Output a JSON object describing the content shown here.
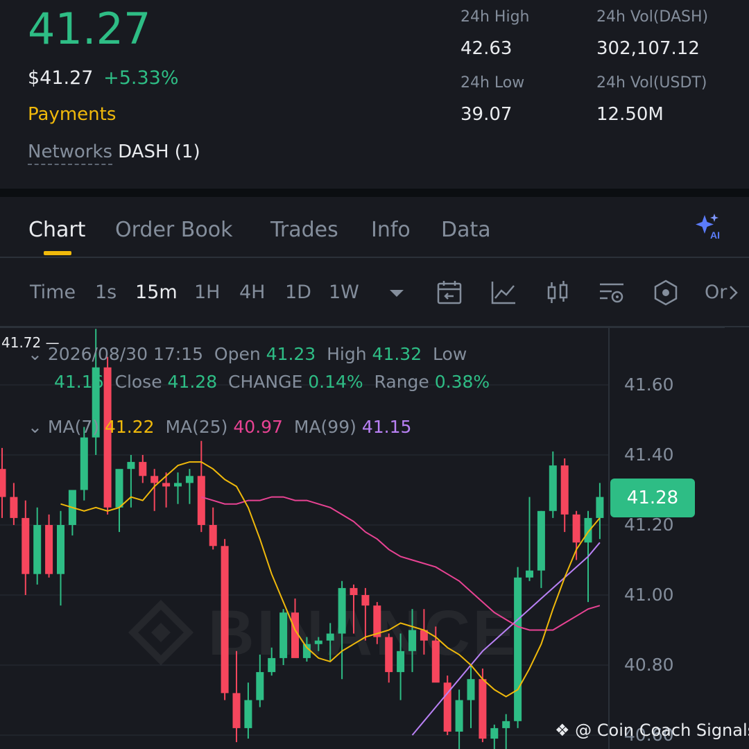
{
  "ticker": {
    "last_price": "41.27",
    "usd_price": "$41.27",
    "change_pct": "+5.33%",
    "category": "Payments",
    "networks_label": "Networks",
    "networks_value": "DASH (1)"
  },
  "stats": {
    "high_label": "24h High",
    "high_value": "42.63",
    "low_label": "24h Low",
    "low_value": "39.07",
    "vol_base_label": "24h Vol(DASH)",
    "vol_base_value": "302,107.12",
    "vol_quote_label": "24h Vol(USDT)",
    "vol_quote_value": "12.50M"
  },
  "tabs": [
    "Chart",
    "Order Book",
    "Trades",
    "Info",
    "Data"
  ],
  "intervals": [
    "Time",
    "1s",
    "15m",
    "1H",
    "4H",
    "1D",
    "1W"
  ],
  "intervals_more": "Or",
  "candle_info": {
    "datetime": "2026/08/30 17:15",
    "open_label": "Open",
    "open": "41.23",
    "high_label": "High",
    "high": "41.32",
    "low_label": "Low",
    "low": "41.16",
    "close_label": "Close",
    "close": "41.28",
    "change_label": "CHANGE",
    "change": "0.14%",
    "range_label": "Range",
    "range": "0.38%"
  },
  "ma_info": {
    "ma7_label": "MA(7)",
    "ma7": "41.22",
    "ma25_label": "MA(25)",
    "ma25": "40.97",
    "ma99_label": "MA(99)",
    "ma99": "41.15"
  },
  "chart": {
    "high_marker": "41.72",
    "last_price_badge": "41.28",
    "y_ticks": [
      "41.60",
      "41.40",
      "41.20",
      "41.00",
      "40.80",
      "40.60"
    ],
    "watermark_text": "BINANCE",
    "credit": "@ Coin Coach Signals"
  },
  "colors": {
    "up": "#2ebd85",
    "down": "#f6465d",
    "accent": "#f0b90b",
    "ma7": "#f0b90b",
    "ma25": "#e84393",
    "ma99": "#b981f5"
  },
  "chart_data": {
    "type": "candlestick",
    "ylim": [
      40.6,
      41.75
    ],
    "candles": [
      {
        "o": 41.36,
        "h": 41.42,
        "l": 41.22,
        "c": 41.28
      },
      {
        "o": 41.28,
        "h": 41.32,
        "l": 41.2,
        "c": 41.22
      },
      {
        "o": 41.22,
        "h": 41.27,
        "l": 41.0,
        "c": 41.06
      },
      {
        "o": 41.06,
        "h": 41.25,
        "l": 41.03,
        "c": 41.2
      },
      {
        "o": 41.2,
        "h": 41.23,
        "l": 41.05,
        "c": 41.06
      },
      {
        "o": 41.06,
        "h": 41.24,
        "l": 40.97,
        "c": 41.2
      },
      {
        "o": 41.2,
        "h": 41.3,
        "l": 41.17,
        "c": 41.3
      },
      {
        "o": 41.3,
        "h": 41.48,
        "l": 41.27,
        "c": 41.45
      },
      {
        "o": 41.45,
        "h": 41.76,
        "l": 41.4,
        "c": 41.65
      },
      {
        "o": 41.65,
        "h": 41.68,
        "l": 41.23,
        "c": 41.25
      },
      {
        "o": 41.25,
        "h": 41.32,
        "l": 41.18,
        "c": 41.36
      },
      {
        "o": 41.36,
        "h": 41.4,
        "l": 41.25,
        "c": 41.38
      },
      {
        "o": 41.38,
        "h": 41.4,
        "l": 41.32,
        "c": 41.34
      },
      {
        "o": 41.34,
        "h": 41.36,
        "l": 41.24,
        "c": 41.32
      },
      {
        "o": 41.32,
        "h": 41.35,
        "l": 41.25,
        "c": 41.31
      },
      {
        "o": 41.31,
        "h": 41.35,
        "l": 41.26,
        "c": 41.32
      },
      {
        "o": 41.32,
        "h": 41.36,
        "l": 41.26,
        "c": 41.34
      },
      {
        "o": 41.34,
        "h": 41.44,
        "l": 41.18,
        "c": 41.2
      },
      {
        "o": 41.2,
        "h": 41.25,
        "l": 41.13,
        "c": 41.14
      },
      {
        "o": 41.14,
        "h": 41.16,
        "l": 40.7,
        "c": 40.72
      },
      {
        "o": 40.72,
        "h": 40.84,
        "l": 40.58,
        "c": 40.62
      },
      {
        "o": 40.62,
        "h": 40.75,
        "l": 40.59,
        "c": 40.7
      },
      {
        "o": 40.7,
        "h": 40.83,
        "l": 40.68,
        "c": 40.78
      },
      {
        "o": 40.78,
        "h": 40.85,
        "l": 40.77,
        "c": 40.82
      },
      {
        "o": 40.82,
        "h": 40.96,
        "l": 40.8,
        "c": 40.95
      },
      {
        "o": 40.95,
        "h": 40.99,
        "l": 40.84,
        "c": 40.82
      },
      {
        "o": 40.82,
        "h": 40.88,
        "l": 40.81,
        "c": 40.86
      },
      {
        "o": 40.86,
        "h": 40.88,
        "l": 40.84,
        "c": 40.87
      },
      {
        "o": 40.87,
        "h": 40.92,
        "l": 40.81,
        "c": 40.89
      },
      {
        "o": 40.89,
        "h": 41.04,
        "l": 40.76,
        "c": 41.02
      },
      {
        "o": 41.02,
        "h": 41.03,
        "l": 40.89,
        "c": 41.0
      },
      {
        "o": 41.0,
        "h": 41.02,
        "l": 40.87,
        "c": 40.97
      },
      {
        "o": 40.97,
        "h": 40.98,
        "l": 40.86,
        "c": 40.88
      },
      {
        "o": 40.88,
        "h": 40.89,
        "l": 40.75,
        "c": 40.78
      },
      {
        "o": 40.78,
        "h": 40.89,
        "l": 40.7,
        "c": 40.84
      },
      {
        "o": 40.84,
        "h": 40.96,
        "l": 40.78,
        "c": 40.9
      },
      {
        "o": 40.9,
        "h": 40.96,
        "l": 40.83,
        "c": 40.87
      },
      {
        "o": 40.87,
        "h": 40.91,
        "l": 40.8,
        "c": 40.75
      },
      {
        "o": 40.75,
        "h": 40.77,
        "l": 40.6,
        "c": 40.61
      },
      {
        "o": 40.61,
        "h": 40.73,
        "l": 40.56,
        "c": 40.7
      },
      {
        "o": 40.7,
        "h": 40.8,
        "l": 40.62,
        "c": 40.76
      },
      {
        "o": 40.76,
        "h": 40.79,
        "l": 40.58,
        "c": 40.59
      },
      {
        "o": 40.59,
        "h": 40.63,
        "l": 40.56,
        "c": 40.62
      },
      {
        "o": 40.62,
        "h": 40.66,
        "l": 40.56,
        "c": 40.64
      },
      {
        "o": 40.64,
        "h": 41.08,
        "l": 40.62,
        "c": 41.05
      },
      {
        "o": 41.05,
        "h": 41.28,
        "l": 41.04,
        "c": 41.07
      },
      {
        "o": 41.07,
        "h": 41.24,
        "l": 41.02,
        "c": 41.24
      },
      {
        "o": 41.24,
        "h": 41.41,
        "l": 41.22,
        "c": 41.37
      },
      {
        "o": 41.37,
        "h": 41.39,
        "l": 41.18,
        "c": 41.23
      },
      {
        "o": 41.23,
        "h": 41.24,
        "l": 41.1,
        "c": 41.15
      },
      {
        "o": 41.15,
        "h": 41.24,
        "l": 40.98,
        "c": 41.22
      },
      {
        "o": 41.22,
        "h": 41.32,
        "l": 41.16,
        "c": 41.28
      }
    ],
    "ma7": [
      41.26,
      41.25,
      41.24,
      41.25,
      41.24,
      41.25,
      41.28,
      41.27,
      41.31,
      41.34,
      41.37,
      41.38,
      41.38,
      41.36,
      41.33,
      41.31,
      41.25,
      41.16,
      41.06,
      40.98,
      40.9,
      40.85,
      40.82,
      40.81,
      40.84,
      40.86,
      40.88,
      40.89,
      40.9,
      40.92,
      40.91,
      40.9,
      40.88,
      40.85,
      40.83,
      40.8,
      40.76,
      40.73,
      40.71,
      40.73,
      40.79,
      40.86,
      40.96,
      41.05,
      41.13,
      41.18,
      41.22
    ],
    "ma25": [
      41.28,
      41.27,
      41.26,
      41.26,
      41.27,
      41.27,
      41.28,
      41.28,
      41.27,
      41.27,
      41.26,
      41.25,
      41.23,
      41.21,
      41.18,
      41.16,
      41.13,
      41.11,
      41.1,
      41.09,
      41.08,
      41.06,
      41.04,
      41.01,
      40.98,
      40.95,
      40.93,
      40.91,
      40.9,
      40.9,
      40.9,
      40.92,
      40.94,
      40.96,
      40.97
    ],
    "ma99": [
      40.6,
      40.64,
      40.68,
      40.72,
      40.76,
      40.8,
      40.84,
      40.87,
      40.9,
      40.93,
      40.96,
      40.99,
      41.02,
      41.05,
      41.08,
      41.11,
      41.15
    ]
  }
}
